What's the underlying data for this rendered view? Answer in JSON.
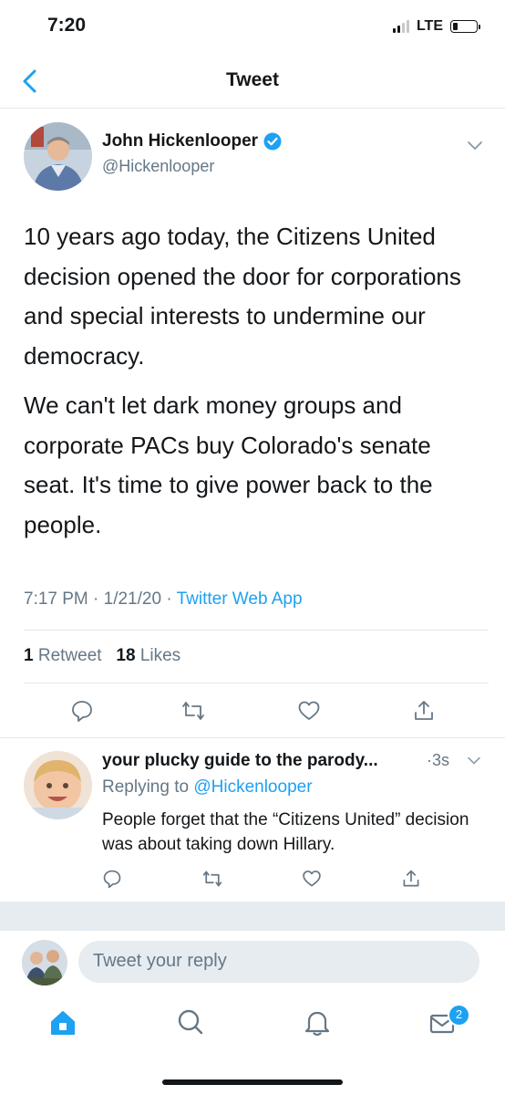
{
  "status_bar": {
    "time": "7:20",
    "network": "LTE"
  },
  "nav": {
    "title": "Tweet",
    "back_icon": "chevron-left-icon"
  },
  "tweet": {
    "author_name": "John Hickenlooper",
    "author_handle": "@Hickenlooper",
    "verified": true,
    "paragraphs": [
      "10 years ago today, the Citizens United decision opened the door for corporations and special interests to undermine our democracy.",
      "We can't let dark money groups and corporate PACs buy Colorado's senate seat. It's time to give power back to the people."
    ],
    "timestamp": "7:17 PM · 1/21/20 · ",
    "source": "Twitter Web App",
    "retweet_count": "1",
    "retweet_label": "Retweet",
    "like_count": "18",
    "like_label": "Likes"
  },
  "reply": {
    "author_name": "your plucky guide to the parody...",
    "time": "·3s",
    "replying_prefix": "Replying to ",
    "replying_handle": "@Hickenlooper",
    "text": "People forget that the “Citizens United” decision was about taking down Hillary."
  },
  "compose": {
    "placeholder": "Tweet your reply"
  },
  "tab_bar": {
    "messages_badge": "2"
  },
  "colors": {
    "accent": "#1da1f2",
    "secondary_text": "#657786",
    "divider": "#e1e8ed"
  }
}
